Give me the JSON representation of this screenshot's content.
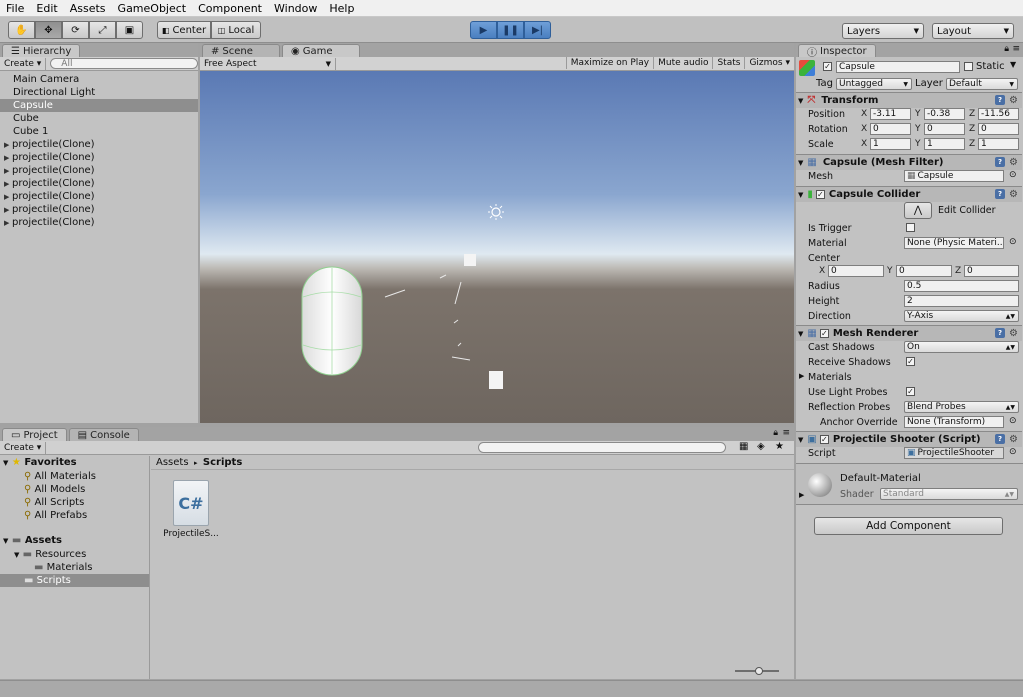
{
  "menu": [
    "File",
    "Edit",
    "Assets",
    "GameObject",
    "Component",
    "Window",
    "Help"
  ],
  "toolbar": {
    "center_label": "Center",
    "local_label": "Local",
    "layers_label": "Layers",
    "layout_label": "Layout"
  },
  "hierarchy": {
    "tab_label": "Hierarchy",
    "create_label": "Create",
    "search_placeholder": "All",
    "items": [
      {
        "label": "Main Camera",
        "expandable": false
      },
      {
        "label": "Directional Light",
        "expandable": false
      },
      {
        "label": "Capsule",
        "expandable": false,
        "selected": true
      },
      {
        "label": "Cube",
        "expandable": false
      },
      {
        "label": "Cube 1",
        "expandable": false
      },
      {
        "label": "projectile(Clone)",
        "expandable": true
      },
      {
        "label": "projectile(Clone)",
        "expandable": true
      },
      {
        "label": "projectile(Clone)",
        "expandable": true
      },
      {
        "label": "projectile(Clone)",
        "expandable": true
      },
      {
        "label": "projectile(Clone)",
        "expandable": true
      },
      {
        "label": "projectile(Clone)",
        "expandable": true
      },
      {
        "label": "projectile(Clone)",
        "expandable": true
      }
    ]
  },
  "game": {
    "scene_tab": "Scene",
    "game_tab": "Game",
    "aspect_label": "Free Aspect",
    "maximize_label": "Maximize on Play",
    "mute_label": "Mute audio",
    "stats_label": "Stats",
    "gizmos_label": "Gizmos"
  },
  "project": {
    "project_tab": "Project",
    "console_tab": "Console",
    "create_label": "Create",
    "favorites_label": "Favorites",
    "favorites": [
      "All Materials",
      "All Models",
      "All Scripts",
      "All Prefabs"
    ],
    "assets_label": "Assets",
    "resources_label": "Resources",
    "materials_label": "Materials",
    "scripts_label": "Scripts",
    "breadcrumb_root": "Assets",
    "breadcrumb_current": "Scripts",
    "file_name": "ProjectileS...",
    "file_glyph": "C#"
  },
  "inspector": {
    "tab_label": "Inspector",
    "object_name": "Capsule",
    "static_label": "Static",
    "tag_label": "Tag",
    "tag_value": "Untagged",
    "layer_label": "Layer",
    "layer_value": "Default",
    "transform": {
      "title": "Transform",
      "position_label": "Position",
      "rotation_label": "Rotation",
      "scale_label": "Scale",
      "position": [
        "-3.11",
        "-0.38",
        "-11.56"
      ],
      "rotation": [
        "0",
        "0",
        "0"
      ],
      "scale": [
        "1",
        "1",
        "1"
      ]
    },
    "mesh_filter": {
      "title": "Capsule (Mesh Filter)",
      "mesh_label": "Mesh",
      "mesh_value": "Capsule"
    },
    "collider": {
      "title": "Capsule Collider",
      "edit_label": "Edit Collider",
      "trigger_label": "Is Trigger",
      "material_label": "Material",
      "material_value": "None (Physic Materi...",
      "center_label": "Center",
      "center": [
        "0",
        "0",
        "0"
      ],
      "radius_label": "Radius",
      "radius_value": "0.5",
      "height_label": "Height",
      "height_value": "2",
      "direction_label": "Direction",
      "direction_value": "Y-Axis"
    },
    "renderer": {
      "title": "Mesh Renderer",
      "cast_label": "Cast Shadows",
      "cast_value": "On",
      "receive_label": "Receive Shadows",
      "materials_label": "Materials",
      "probes_label": "Use Light Probes",
      "reflection_label": "Reflection Probes",
      "reflection_value": "Blend Probes",
      "anchor_label": "Anchor Override",
      "anchor_value": "None (Transform)"
    },
    "script": {
      "title": "Projectile Shooter (Script)",
      "script_label": "Script",
      "script_value": "ProjectileShooter"
    },
    "material": {
      "name": "Default-Material",
      "shader_label": "Shader",
      "shader_value": "Standard"
    },
    "add_component_label": "Add Component"
  },
  "axis_labels": [
    "X",
    "Y",
    "Z"
  ],
  "colors": {
    "play_blue": "#4a7fc0",
    "selection_gray": "#8e8e8e",
    "sky_top": "#5a79b4",
    "ground": "#6e665f"
  }
}
